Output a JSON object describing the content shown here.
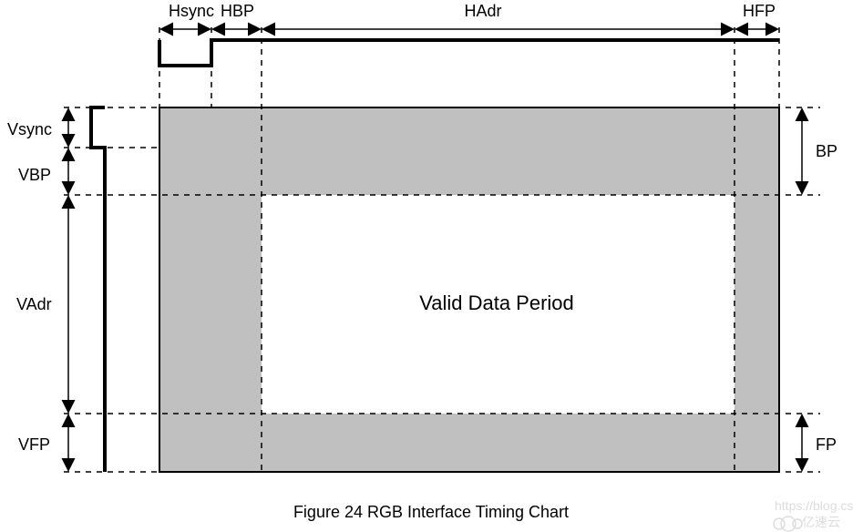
{
  "labels": {
    "hsync": "Hsync",
    "hbp": "HBP",
    "hadr": "HAdr",
    "hfp": "HFP",
    "vsync": "Vsync",
    "vbp": "VBP",
    "vadr": "VAdr",
    "vfp": "VFP",
    "bp": "BP",
    "fp": "FP",
    "valid": "Valid Data Period"
  },
  "caption": "Figure 24 RGB Interface Timing Chart",
  "watermark": "https://blog.cs",
  "watermark2": "亿速云"
}
